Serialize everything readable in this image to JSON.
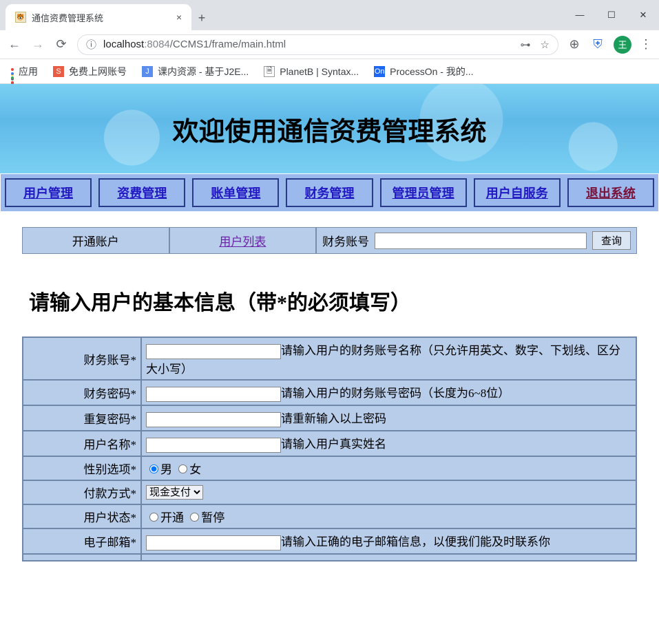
{
  "browser": {
    "tab_title": "通信资费管理系统",
    "url_info_icon": "ⓘ",
    "url_host": "localhost",
    "url_port": ":8084",
    "url_path": "/CCMS1/frame/main.html",
    "avatar_letter": "王",
    "bookmarks": {
      "apps": "应用",
      "b1": "免费上网账号",
      "b2": "课内资源 - 基于J2E...",
      "b3": "PlanetB | Syntax...",
      "b4": "ProcessOn - 我的..."
    }
  },
  "banner_title": "欢迎使用通信资费管理系统",
  "menu": {
    "m1": "用户管理",
    "m2": "资费管理",
    "m3": "账单管理",
    "m4": "财务管理",
    "m5": "管理员管理",
    "m6": "用户自服务",
    "m7": "退出系统"
  },
  "subbar": {
    "open": "开通账户",
    "list": "用户列表",
    "search_label": "财务账号",
    "search_btn": "查询"
  },
  "form_title": "请输入用户的基本信息（带*的必须填写）",
  "rows": {
    "r1": {
      "label": "财务账号*",
      "hint": "请输入用户的财务账号名称（只允许用英文、数字、下划线、区分大小写）"
    },
    "r2": {
      "label": "财务密码*",
      "hint": "请输入用户的财务账号密码（长度为6~8位）"
    },
    "r3": {
      "label": "重复密码*",
      "hint": "请重新输入以上密码"
    },
    "r4": {
      "label": "用户名称*",
      "hint": "请输入用户真实姓名"
    },
    "r5": {
      "label": "性别选项*",
      "opt1": "男",
      "opt2": "女"
    },
    "r6": {
      "label": "付款方式*",
      "opt1": "现金支付"
    },
    "r7": {
      "label": "用户状态*",
      "opt1": "开通",
      "opt2": "暂停"
    },
    "r8": {
      "label": "电子邮箱*",
      "hint": "请输入正确的电子邮箱信息，以便我们能及时联系你"
    }
  }
}
